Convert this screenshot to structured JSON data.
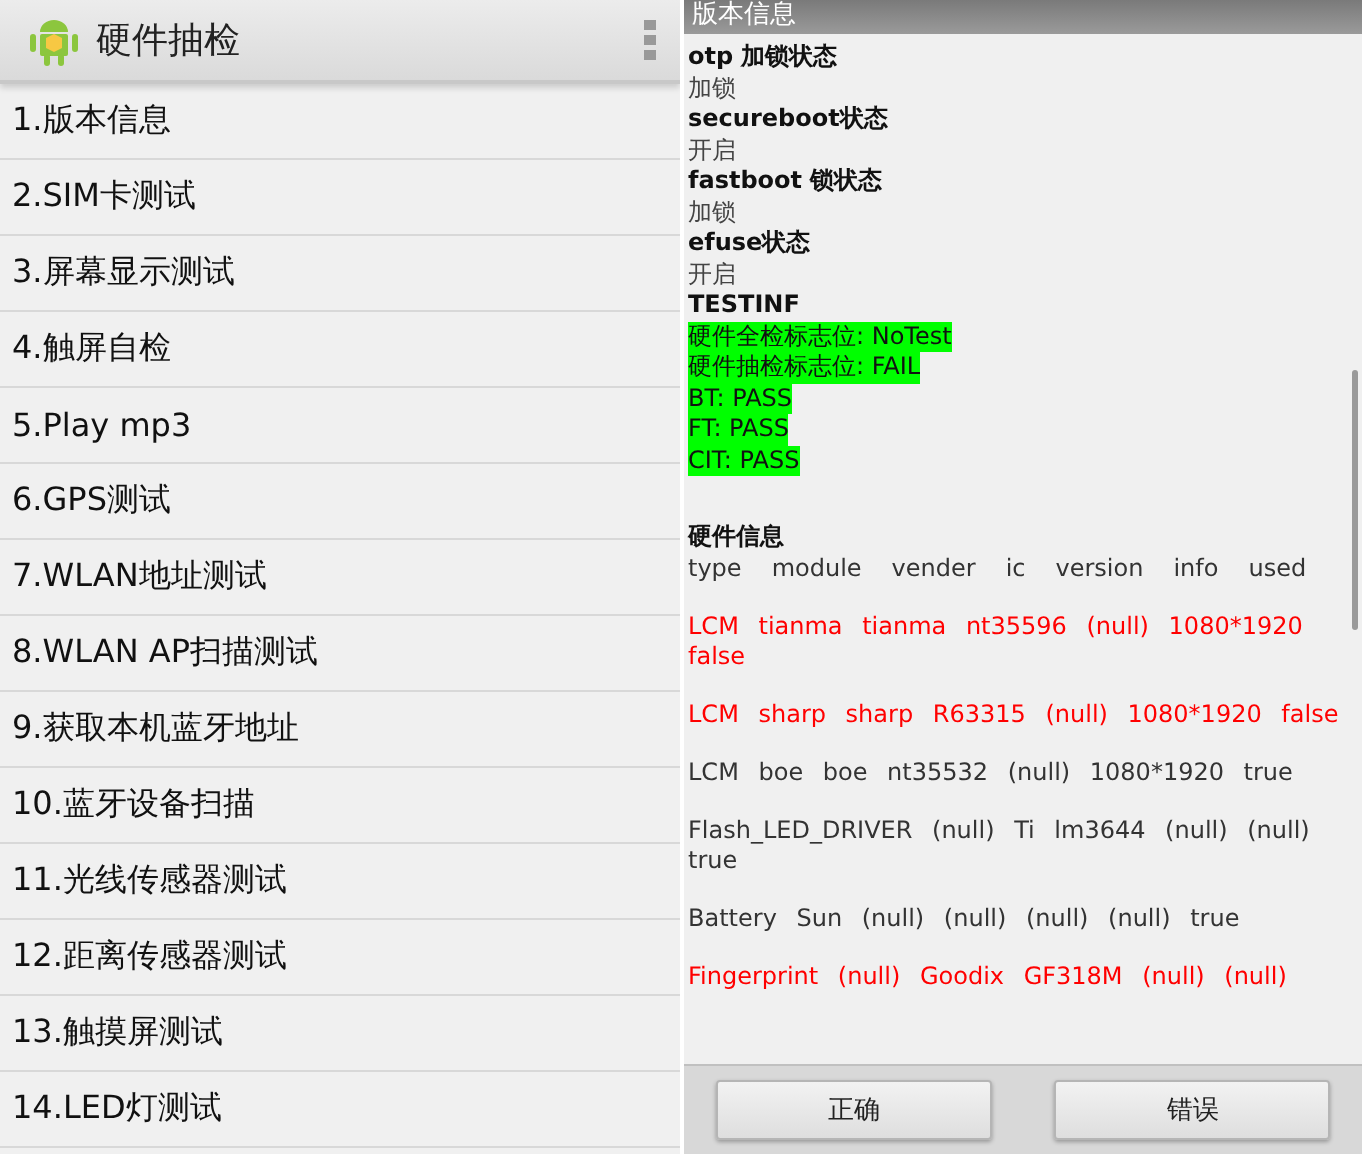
{
  "left": {
    "app_title": "硬件抽检",
    "items": [
      "1.版本信息",
      "2.SIM卡测试",
      "3.屏幕显示测试",
      "4.触屏自检",
      "5.Play mp3",
      "6.GPS测试",
      "7.WLAN地址测试",
      "8.WLAN AP扫描测试",
      "9.获取本机蓝牙地址",
      "10.蓝牙设备扫描",
      "11.光线传感器测试",
      "12.距离传感器测试",
      "13.触摸屏测试",
      "14.LED灯测试"
    ]
  },
  "right": {
    "title": "版本信息",
    "lines": [
      {
        "kind": "heading",
        "text": "otp 加锁状态"
      },
      {
        "kind": "value",
        "text": "加锁"
      },
      {
        "kind": "heading",
        "text": "secureboot状态"
      },
      {
        "kind": "value",
        "text": "开启"
      },
      {
        "kind": "heading",
        "text": "fastboot 锁状态"
      },
      {
        "kind": "value",
        "text": "加锁"
      },
      {
        "kind": "heading",
        "text": "efuse状态"
      },
      {
        "kind": "value",
        "text": "开启"
      },
      {
        "kind": "heading",
        "text": "TESTINF"
      },
      {
        "kind": "flag",
        "text": "硬件全检标志位:  NoTest"
      },
      {
        "kind": "flag",
        "text": "硬件抽检标志位:  FAIL"
      },
      {
        "kind": "flag",
        "text": "BT: PASS"
      },
      {
        "kind": "flag",
        "text": "FT: PASS"
      },
      {
        "kind": "flag",
        "text": "CIT: PASS"
      }
    ],
    "hardware_title": "硬件信息",
    "columns": [
      "type",
      "module",
      "vender",
      "ic",
      "version",
      "info",
      "used"
    ],
    "rows": [
      {
        "text": "LCM tianma tianma nt35596 (null) 1080*1920 false",
        "color": "#ff0000"
      },
      {
        "text": "LCM sharp sharp R63315 (null) 1080*1920 false",
        "color": "#ff0000"
      },
      {
        "text": "LCM boe boe nt35532 (null) 1080*1920 true",
        "color": "#333333"
      },
      {
        "text": "Flash_LED_DRIVER (null) Ti lm3644 (null) (null) true",
        "color": "#333333"
      },
      {
        "text": "Battery Sun (null) (null) (null) (null) true",
        "color": "#333333"
      },
      {
        "text": "Fingerprint (null) Goodix GF318M (null) (null)",
        "color": "#ff0000"
      }
    ],
    "buttons": [
      "正确",
      "错误"
    ]
  }
}
